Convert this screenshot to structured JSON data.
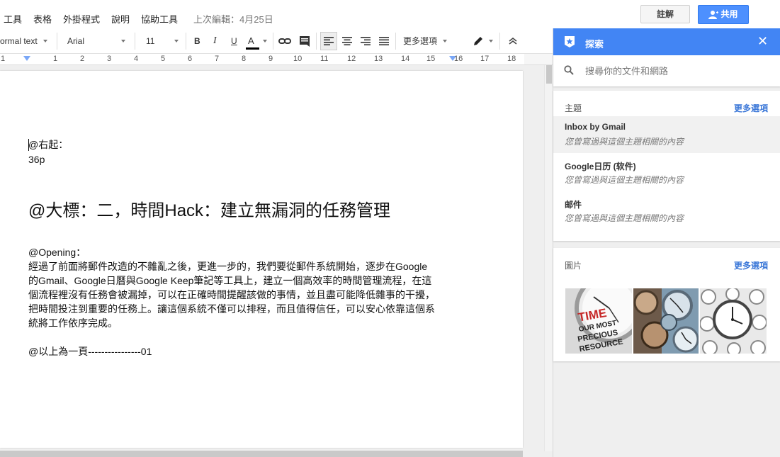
{
  "menu": {
    "items": [
      "工具",
      "表格",
      "外掛程式",
      "說明",
      "協助工具"
    ],
    "last_edit": "上次編輯：4月25日"
  },
  "header": {
    "comment_label": "註解",
    "share_label": "共用"
  },
  "toolbar": {
    "style": "ormal text",
    "font": "Arial",
    "size": "11",
    "bold": "B",
    "italic": "I",
    "underline": "U",
    "text_color": "A",
    "more": "更多選項"
  },
  "ruler": {
    "numbers": [
      "1",
      "1",
      "2",
      "3",
      "4",
      "5",
      "6",
      "7",
      "8",
      "9",
      "10",
      "11",
      "12",
      "13",
      "14",
      "15",
      "16",
      "17",
      "18"
    ]
  },
  "document": {
    "line1": "@右起：",
    "line2": "36p",
    "heading": "@大標：二，時間Hack：建立無漏洞的任務管理",
    "opening": "@Opening：",
    "para": [
      "經過了前面將郵件改造的不雜亂之後，更進一步的，我們要從郵件系統開始，逐步在Google",
      "的Gmail、Google日曆與Google Keep筆記等工具上，建立一個高效率的時間管理流程，在這",
      "個流程裡沒有任務會被漏掉，可以在正確時間提醒該做的事情，並且盡可能降低雜事的干擾，",
      "把時間投注到重要的任務上。讓這個系統不僅可以排程，而且值得信任，可以安心依靠這個系",
      "統將工作依序完成。"
    ],
    "footer": "@以上為一頁----------------01"
  },
  "explore": {
    "title": "探索",
    "search_placeholder": "搜尋你的文件和網路",
    "topics_title": "主題",
    "more": "更多選項",
    "topics": [
      {
        "name": "Inbox by Gmail",
        "desc": "您曾寫過與這個主題相關的內容"
      },
      {
        "name": "Google日历 (软件)",
        "desc": "您曾寫過與這個主題相關的內容"
      },
      {
        "name": "邮件",
        "desc": "您曾寫過與這個主題相關的內容"
      }
    ],
    "images_title": "圖片",
    "image1_text": [
      "TIME",
      "OUR MOST",
      "PRECIOUS",
      "RESOURCE"
    ]
  },
  "colors": {
    "accent": "#4285f4",
    "link": "#3c78d8",
    "share": "#4d90fe"
  }
}
